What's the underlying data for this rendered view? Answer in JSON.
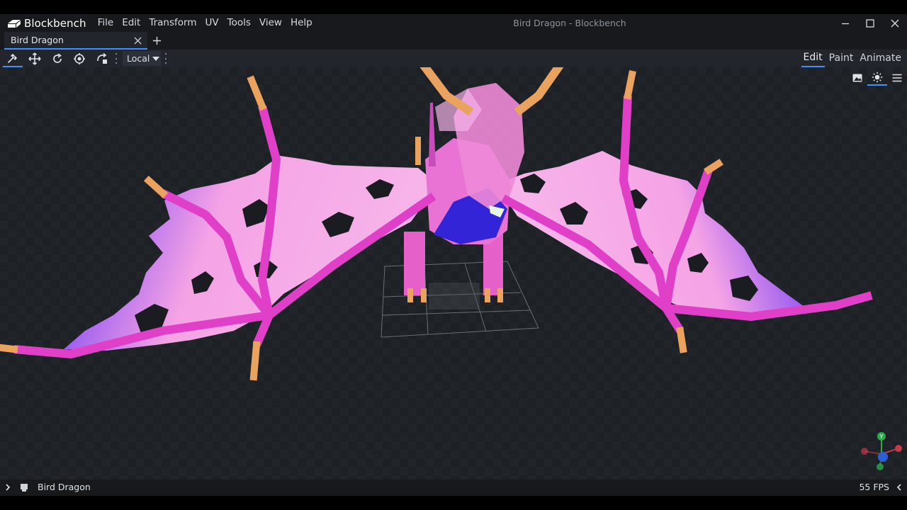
{
  "app": {
    "name": "Blockbench",
    "window_title": "Bird Dragon - Blockbench"
  },
  "menu": {
    "items": [
      "File",
      "Edit",
      "Transform",
      "UV",
      "Tools",
      "View",
      "Help"
    ]
  },
  "tabs": [
    {
      "label": "Bird Dragon"
    }
  ],
  "toolbar": {
    "tools": [
      "move-tool",
      "resize-tool",
      "rotate-tool",
      "pivot-tool",
      "vertex-snap-tool"
    ],
    "transform_space": "Local"
  },
  "modes": [
    "Edit",
    "Paint",
    "Animate"
  ],
  "active_mode": "Edit",
  "gizmo": {
    "y_label": "Y"
  },
  "status": {
    "model_name": "Bird Dragon",
    "fps": "55 FPS"
  },
  "colors": {
    "accent": "#3e90ff",
    "wing_pink": "#e03fc8",
    "wing_membrane": "#f5a3e6",
    "wing_edge": "#2c3cf0",
    "bone_tip": "#e9a35f",
    "viewport_bg": "#1e2125"
  }
}
